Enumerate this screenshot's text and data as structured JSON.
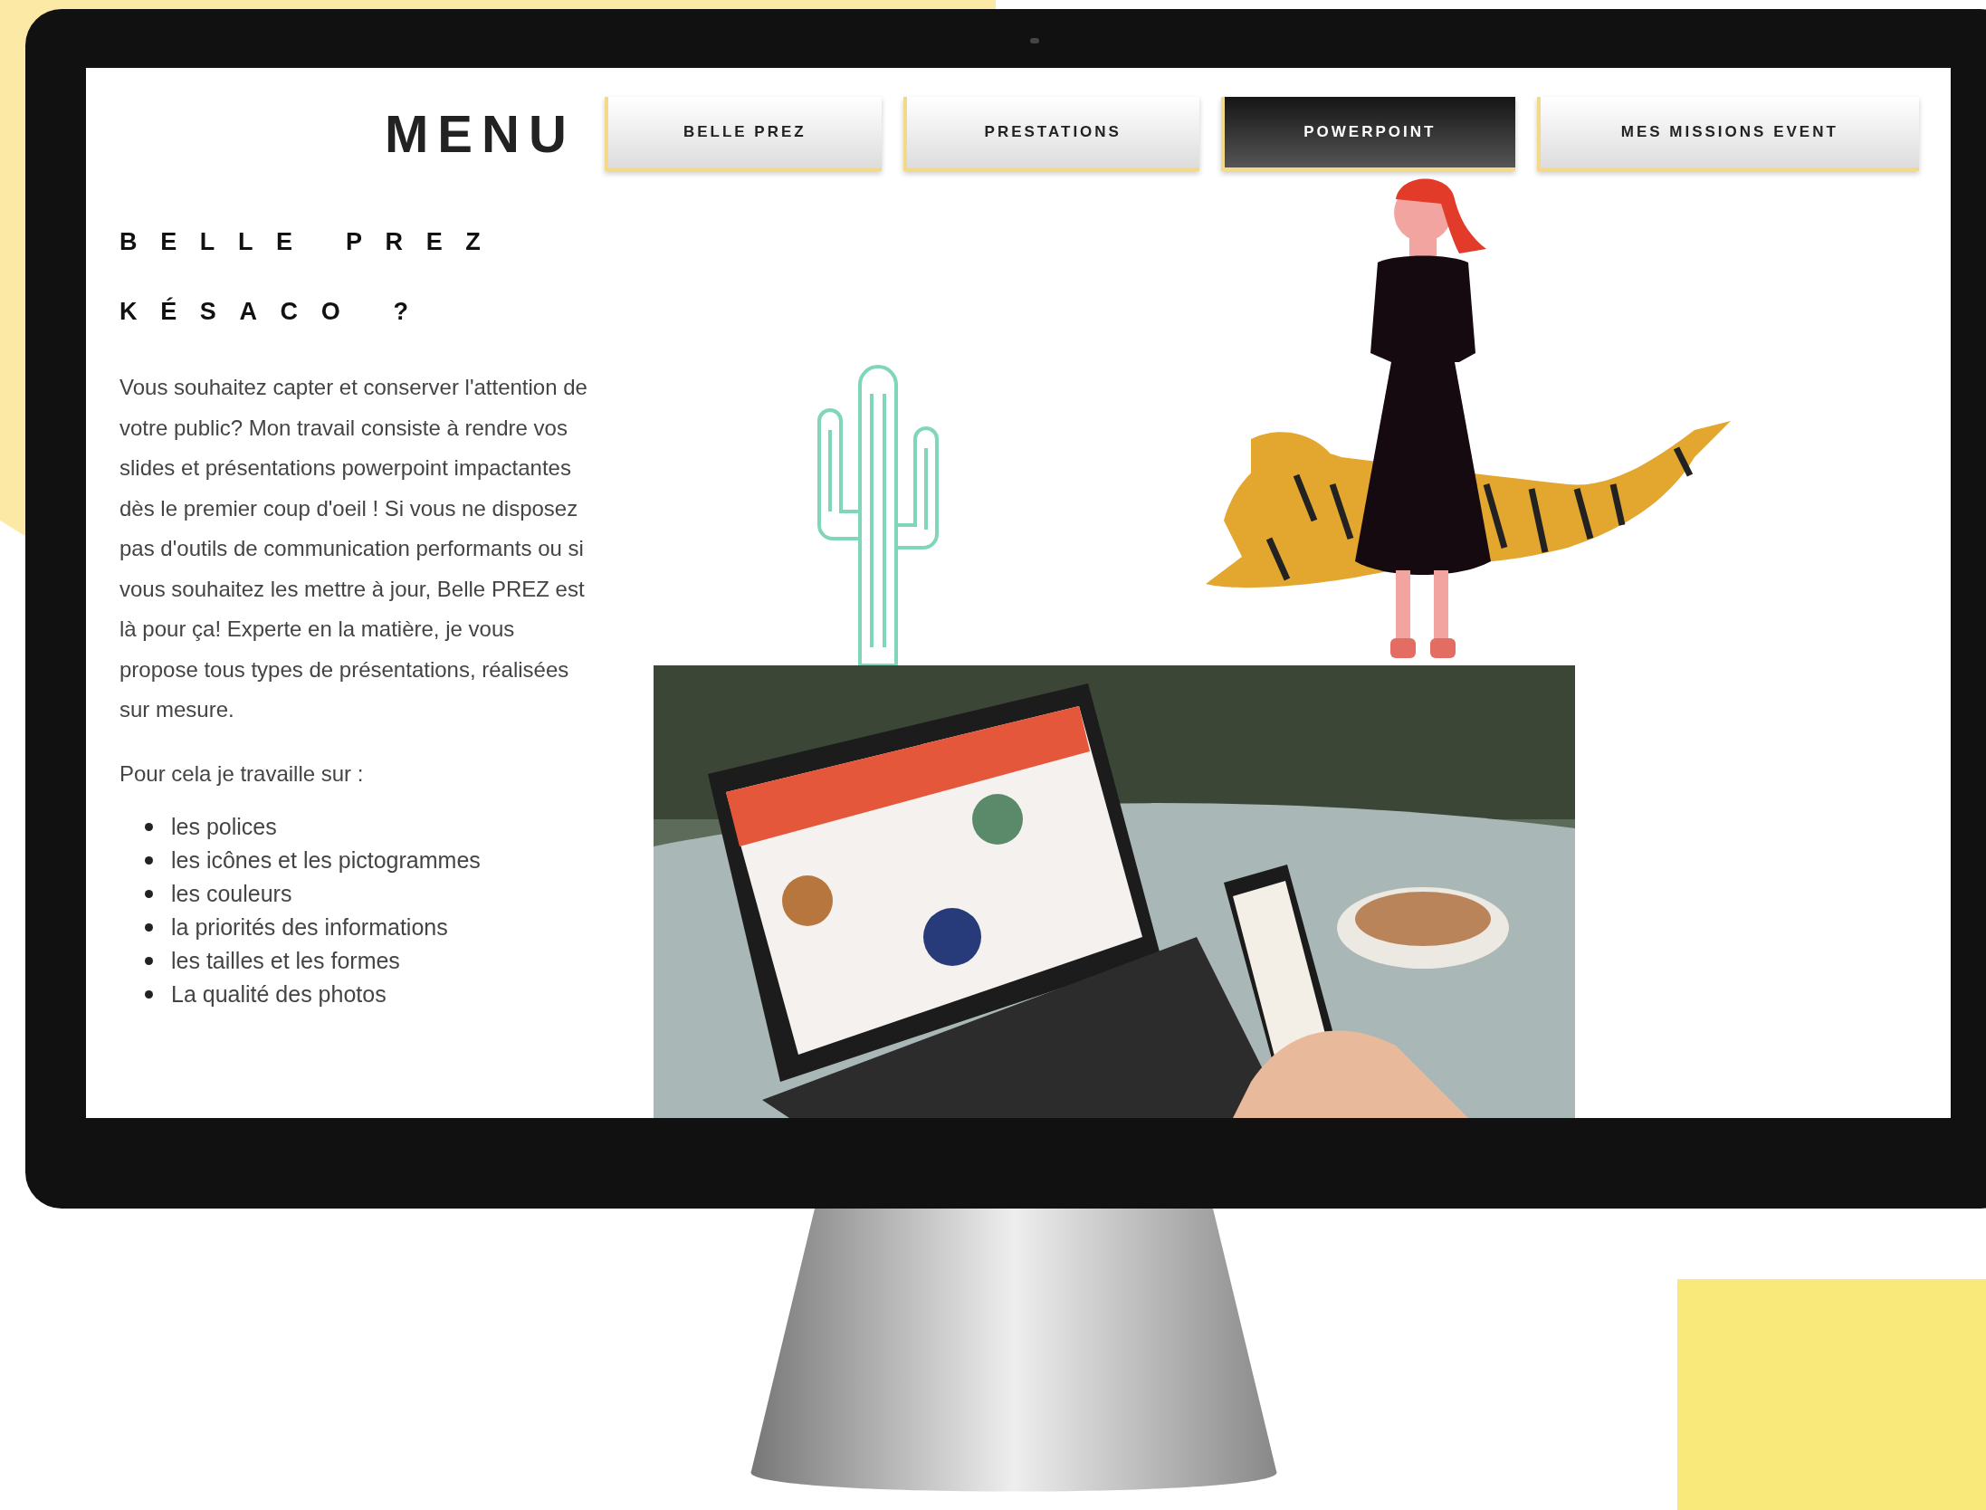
{
  "menu_title": "MENU",
  "tabs": [
    {
      "label": "BELLE PREZ",
      "selected": false
    },
    {
      "label": "PRESTATIONS",
      "selected": false
    },
    {
      "label": "POWERPOINT",
      "selected": true
    },
    {
      "label": "MES MISSIONS EVENT",
      "selected": false
    }
  ],
  "heading": "BELLE PREZ",
  "subheading": "KÉSACO ?",
  "paragraph": "Vous souhaitez capter et conserver l'attention de votre public? Mon travail consiste à rendre vos slides et présentations powerpoint impactantes dès le premier coup d'oeil ! Si vous ne disposez pas d'outils de communication performants ou si vous souhaitez les mettre à jour, Belle PREZ est là pour ça! Experte en la matière, je vous propose tous types de présentations, réalisées sur mesure.",
  "intro": "Pour cela je travaille sur :",
  "list": [
    "les polices",
    "les icônes et les pictogrammes",
    "les couleurs",
    "la priorités des informations",
    "les tailles et les formes",
    "La qualité des photos"
  ]
}
